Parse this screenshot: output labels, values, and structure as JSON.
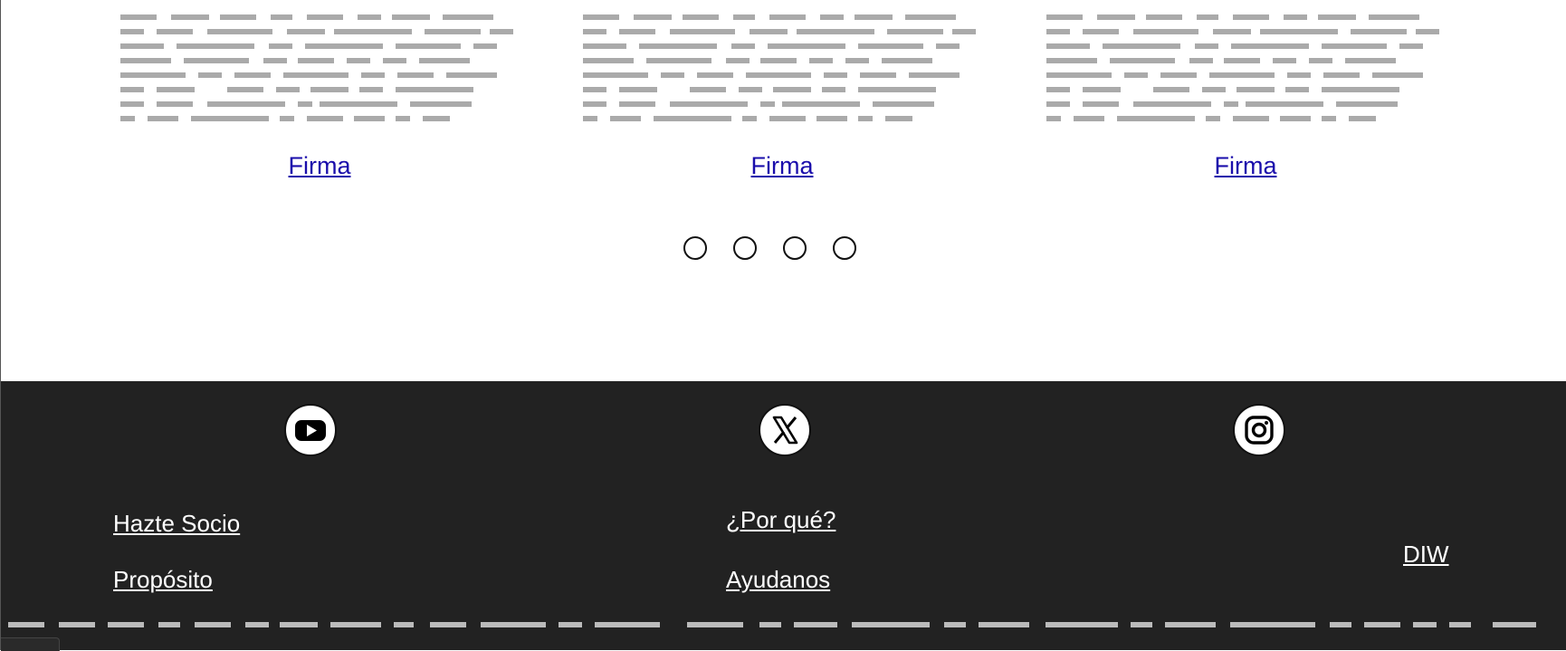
{
  "columns": [
    {
      "link_label": "Firma"
    },
    {
      "link_label": "Firma"
    },
    {
      "link_label": "Firma"
    }
  ],
  "carousel": {
    "dot_count": 4
  },
  "footer": {
    "social": [
      {
        "icon": "youtube-icon"
      },
      {
        "icon": "x-icon"
      },
      {
        "icon": "instagram-icon"
      }
    ],
    "links": {
      "hazte_socio": "Hazte Socio",
      "proposito": "Propósito",
      "por_que": "¿Por qué?",
      "ayudanos": "Ayudanos",
      "diw": "DIW"
    }
  },
  "colors": {
    "footer_bg": "#222222",
    "link": "#1a0dab",
    "placeholder": "#aaaaaa"
  }
}
